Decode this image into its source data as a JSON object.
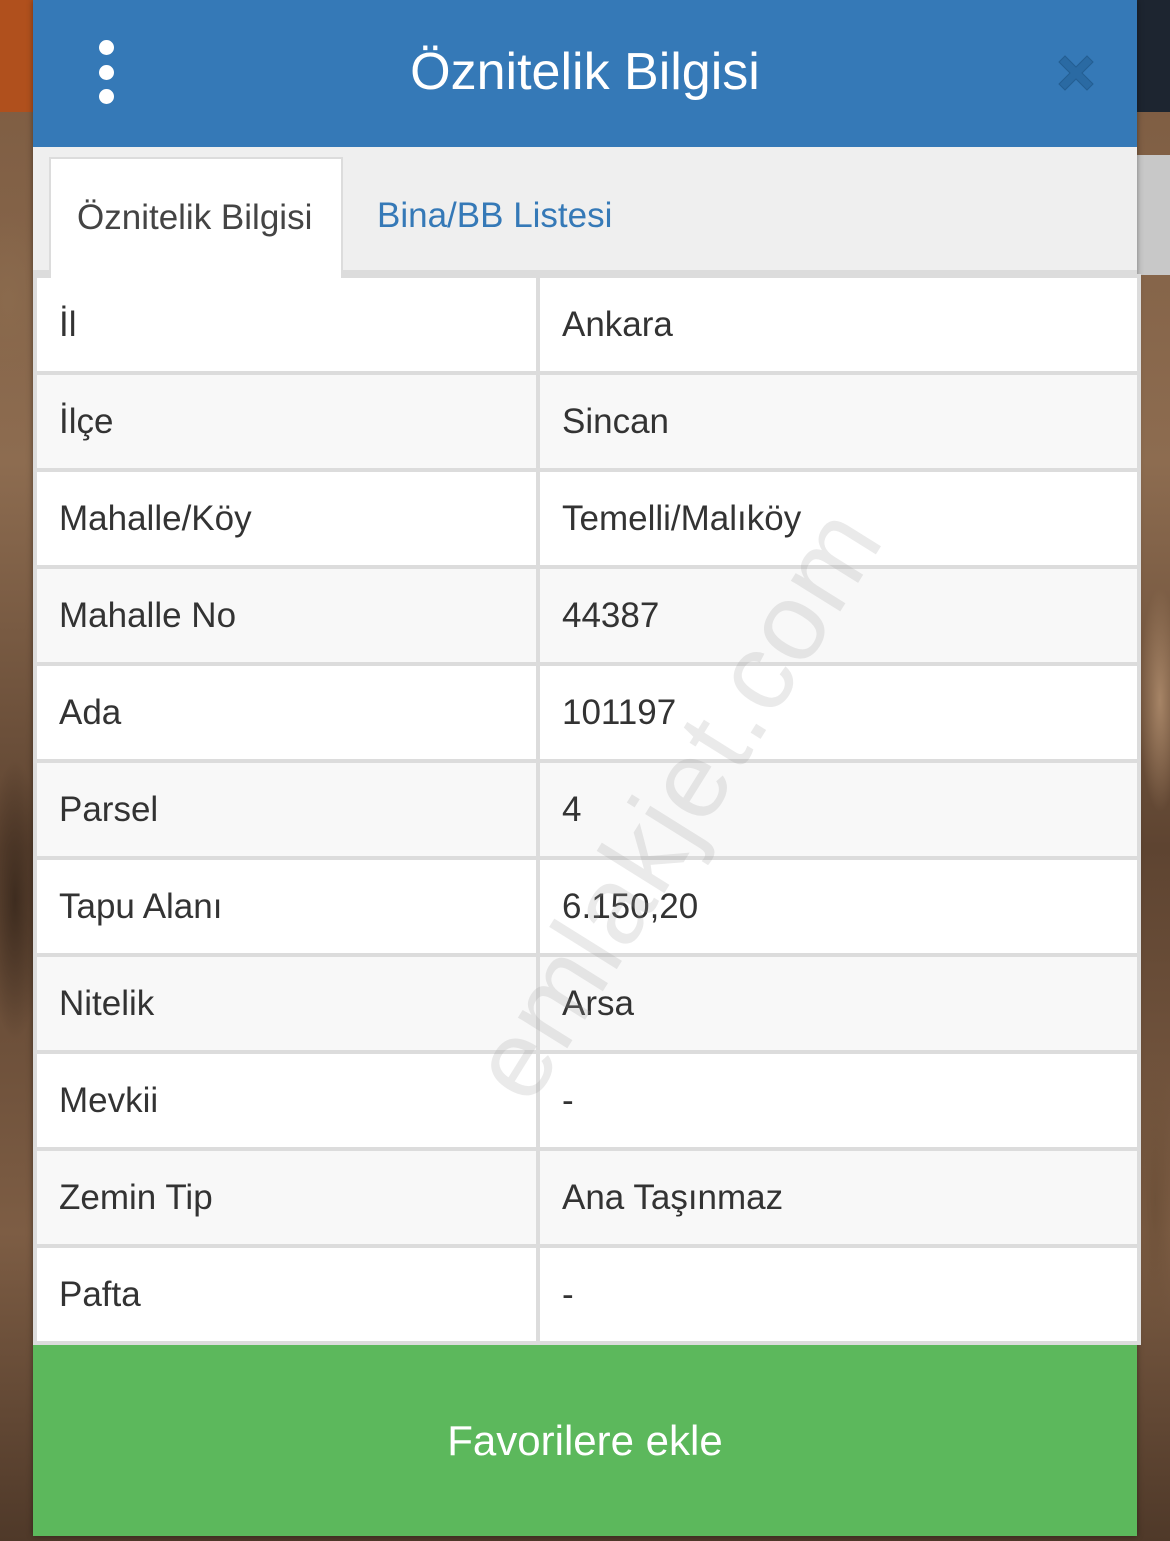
{
  "header": {
    "title": "Öznitelik Bilgisi",
    "menu_icon": "more-vertical-icon",
    "close_icon": "close-icon",
    "color": "#3579b7"
  },
  "tabs": [
    {
      "label": "Öznitelik Bilgisi",
      "active": true
    },
    {
      "label": "Bina/BB Listesi",
      "active": false
    }
  ],
  "attributes": [
    {
      "key": "İl",
      "value": "Ankara"
    },
    {
      "key": "İlçe",
      "value": "Sincan"
    },
    {
      "key": "Mahalle/Köy",
      "value": "Temelli/Malıköy"
    },
    {
      "key": "Mahalle No",
      "value": "44387"
    },
    {
      "key": "Ada",
      "value": "101197"
    },
    {
      "key": "Parsel",
      "value": "4"
    },
    {
      "key": "Tapu Alanı",
      "value": "6.150,20"
    },
    {
      "key": "Nitelik",
      "value": "Arsa"
    },
    {
      "key": "Mevkii",
      "value": "-"
    },
    {
      "key": "Zemin Tip",
      "value": "Ana Taşınmaz"
    },
    {
      "key": "Pafta",
      "value": "-"
    }
  ],
  "footer": {
    "favorite_label": "Favorilere ekle",
    "color": "#5cb85c"
  },
  "watermark": "emlakjet.com"
}
